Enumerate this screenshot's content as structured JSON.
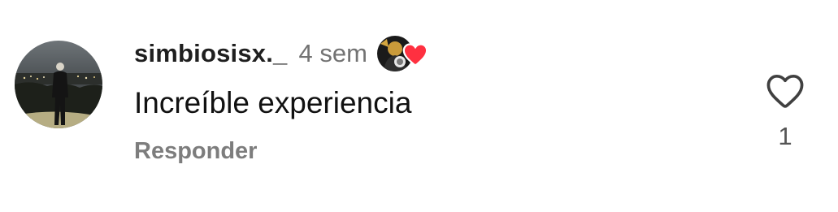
{
  "comment": {
    "username": "simbiosisx._",
    "time_ago": "4 sem",
    "text": "Increíble experiencia",
    "reply_label": "Responder",
    "like_count": "1",
    "liked_by_creator": true,
    "icons": {
      "like": "heart-outline-icon",
      "creator_heart": "heart-filled-icon"
    },
    "colors": {
      "creator_heart": "#ff3040",
      "username": "#1f1f1f",
      "secondary_text": "#737373"
    }
  }
}
